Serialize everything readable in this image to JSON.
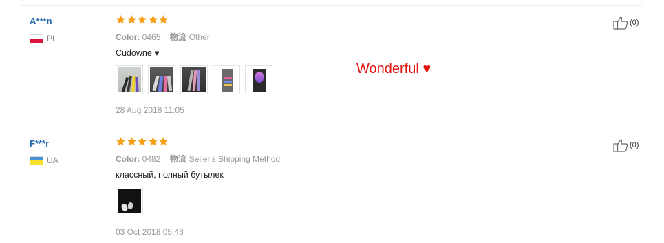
{
  "colors": {
    "accent": "#2468b4",
    "star": "#f6a01a",
    "annotation": "#e0120f",
    "meta_text": "#999999"
  },
  "reviews": [
    {
      "user": "A***n",
      "country": "PL",
      "flag_colors": [
        "#ffffff",
        "#dc143c"
      ],
      "rating": 5,
      "color_label": "Color:",
      "color_value": "0465",
      "logistics_label": "物流",
      "logistics_value": "Other",
      "comment": "Cudowne ♥",
      "photo_icons": [
        "photo-icon",
        "photo-icon",
        "photo-icon",
        "photo-icon",
        "photo-icon"
      ],
      "date": "28 Aug 2018 11:05",
      "helpful_count": "(0)"
    },
    {
      "user": "F***r",
      "country": "UA",
      "flag_colors": [
        "#4a90d9",
        "#f6e02a"
      ],
      "rating": 5,
      "color_label": "Color:",
      "color_value": "0482",
      "logistics_label": "物流",
      "logistics_value": "Seller's Shipping Method",
      "comment": "классный, полный бутылек",
      "photo_icons": [
        "photo-icon"
      ],
      "date": "03 Oct 2018 05:43",
      "helpful_count": "(0)"
    }
  ],
  "annotation": {
    "text": "Wonderful ♥"
  }
}
